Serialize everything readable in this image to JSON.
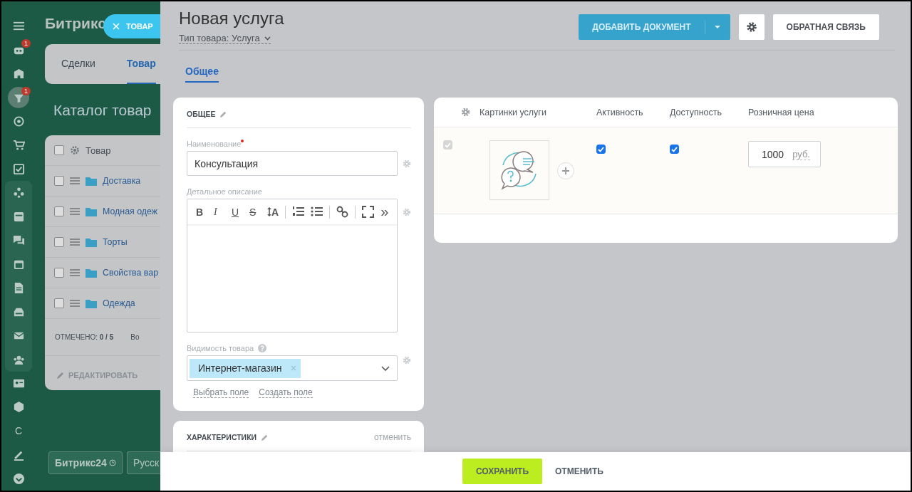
{
  "background_app": {
    "sidebar": {
      "items": [
        {
          "kind": "menu",
          "active": false
        },
        {
          "kind": "robot",
          "active": false,
          "badge": "1"
        },
        {
          "kind": "building",
          "active": false
        },
        {
          "kind": "funnel",
          "active": true,
          "badge": "1"
        },
        {
          "kind": "target",
          "active": false
        },
        {
          "kind": "cart",
          "active": false
        },
        {
          "kind": "checkbox",
          "active": false
        },
        {
          "kind": "nodes",
          "active": false,
          "group": true
        },
        {
          "kind": "window",
          "active": false,
          "group": true
        },
        {
          "kind": "chat",
          "active": false,
          "group": true
        },
        {
          "kind": "calendar",
          "active": false,
          "group": true
        },
        {
          "kind": "document",
          "active": false,
          "group": true
        },
        {
          "kind": "drive",
          "active": false,
          "group": true
        },
        {
          "kind": "mail",
          "active": false,
          "group": true
        },
        {
          "kind": "people",
          "active": false,
          "group": true
        },
        {
          "kind": "card",
          "active": false
        },
        {
          "kind": "cube",
          "active": false
        },
        {
          "kind": "letter",
          "active": false,
          "label": "С"
        },
        {
          "kind": "pen",
          "active": false
        },
        {
          "kind": "chevron",
          "active": false
        }
      ]
    },
    "logo": "Битрикс",
    "tabs": [
      {
        "label": "Сделки",
        "selected": false
      },
      {
        "label": "Товар",
        "selected": true
      }
    ],
    "heading": "Каталог товар",
    "table": {
      "column": "Товар",
      "select_all_checked": false,
      "rows": [
        {
          "name": "Доставка",
          "checked": false
        },
        {
          "name": "Модная одеж",
          "checked": false
        },
        {
          "name": "Торты",
          "checked": false
        },
        {
          "name": "Свойства вар",
          "checked": false
        },
        {
          "name": "Одежда",
          "checked": false
        }
      ],
      "selected_count": "ОТМЕЧЕНО: **0 / 5**",
      "total": "Во",
      "action": "РЕДАКТИРОВАТЬ"
    },
    "footer_buttons": [
      "Битрикс24",
      "Русск"
    ]
  },
  "close_tab": {
    "label": "ТОВАР"
  },
  "slider": {
    "title": "Новая услуга",
    "type": "Тип товара: Услуга",
    "buttons": {
      "add_document": "ДОБАВИТЬ ДОКУМЕНТ",
      "feedback": "ОБРАТНАЯ СВЯЗЬ"
    },
    "tabs": [
      {
        "label": "Общее",
        "selected": true
      }
    ],
    "general_card": {
      "title": "ОБЩЕЕ",
      "name_field": {
        "label": "Наименование",
        "required": true,
        "value": "Консультация"
      },
      "description_field": {
        "label": "Детальное описание",
        "toolbar": [
          {
            "kind": "bold",
            "label": "B"
          },
          {
            "kind": "italic",
            "label": "I"
          },
          {
            "kind": "underline",
            "label": "U"
          },
          {
            "kind": "strike",
            "label": "S"
          },
          {
            "kind": "font-size",
            "label": "A"
          },
          {
            "kind": "separator"
          },
          {
            "kind": "ordered-list"
          },
          {
            "kind": "bullet-list"
          },
          {
            "kind": "separator"
          },
          {
            "kind": "link"
          },
          {
            "kind": "separator"
          },
          {
            "kind": "fullscreen"
          },
          {
            "kind": "more",
            "label": "»"
          }
        ]
      },
      "visibility_field": {
        "label": "Видимость товара",
        "tags": [
          "Интернет-магазин"
        ]
      },
      "links": [
        "Выбрать поле",
        "Создать поле"
      ]
    },
    "properties_card": {
      "title": "ХАРАКТЕРИСТИКИ",
      "action": "отменить"
    },
    "variations": {
      "columns": [
        "Картинки услуги",
        "Активность",
        "Доступность",
        "Розничная цена"
      ],
      "rows": [
        {
          "selected": true,
          "selection_disabled": true,
          "active": true,
          "available": true,
          "price": "1000",
          "currency": "руб."
        }
      ]
    },
    "footer": {
      "save": "СОХРАНИТЬ",
      "cancel": "ОТМЕНИТЬ"
    }
  }
}
